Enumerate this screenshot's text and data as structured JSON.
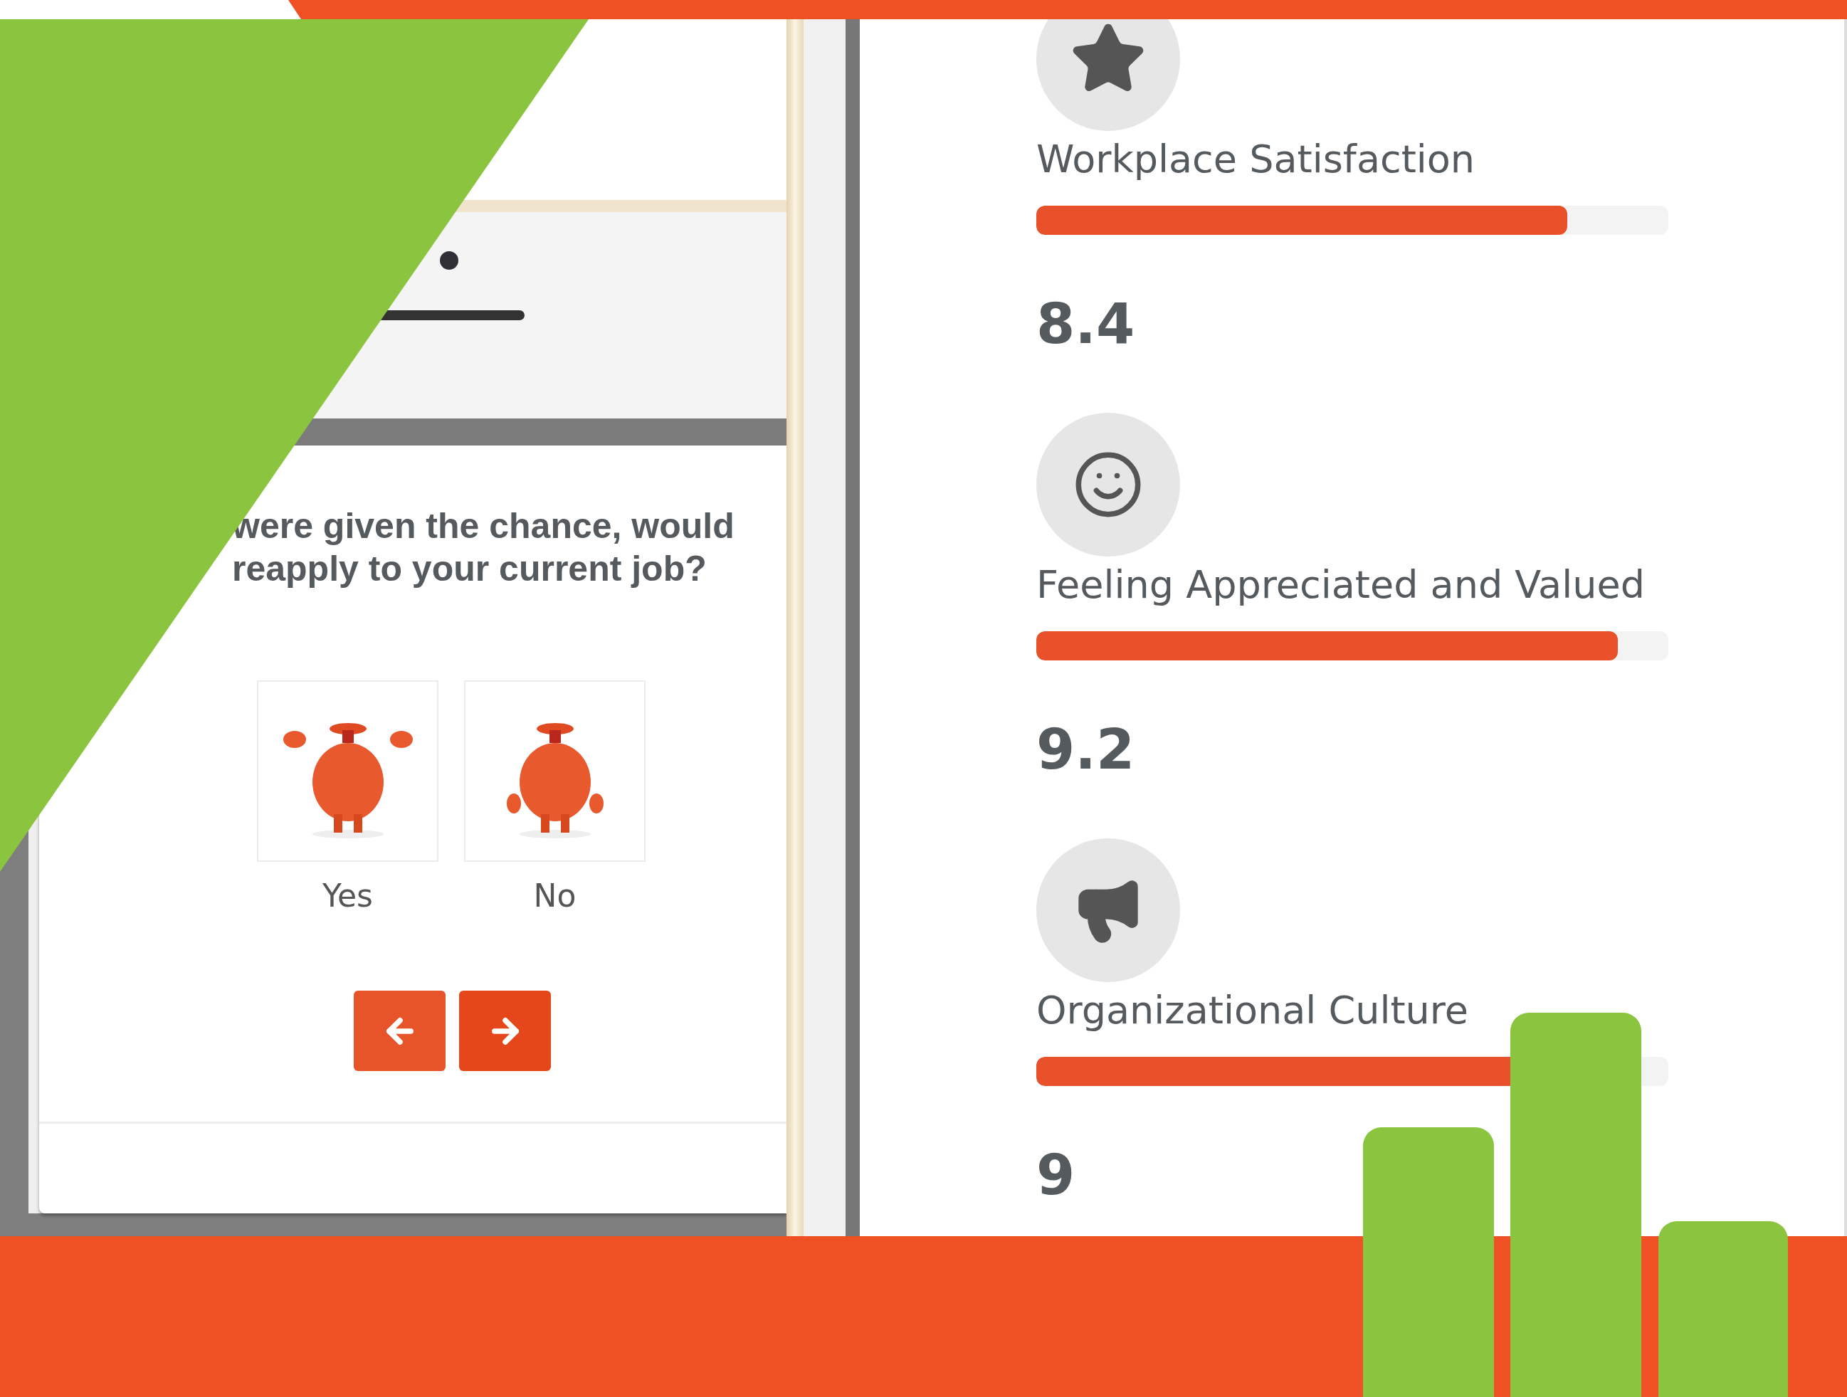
{
  "survey": {
    "question_lines": [
      "were given the chance, would",
      "reapply to your current job?"
    ],
    "options": [
      {
        "label": "Yes"
      },
      {
        "label": "No"
      }
    ]
  },
  "metrics": [
    {
      "title": "Workplace Satisfaction",
      "level": 0.84,
      "score": "8.4"
    },
    {
      "title": "Feeling Appreciated and Valued",
      "level": 0.92,
      "score": "9.2"
    },
    {
      "title": "Organizational Culture",
      "level": 0.9,
      "score": "9"
    }
  ]
}
